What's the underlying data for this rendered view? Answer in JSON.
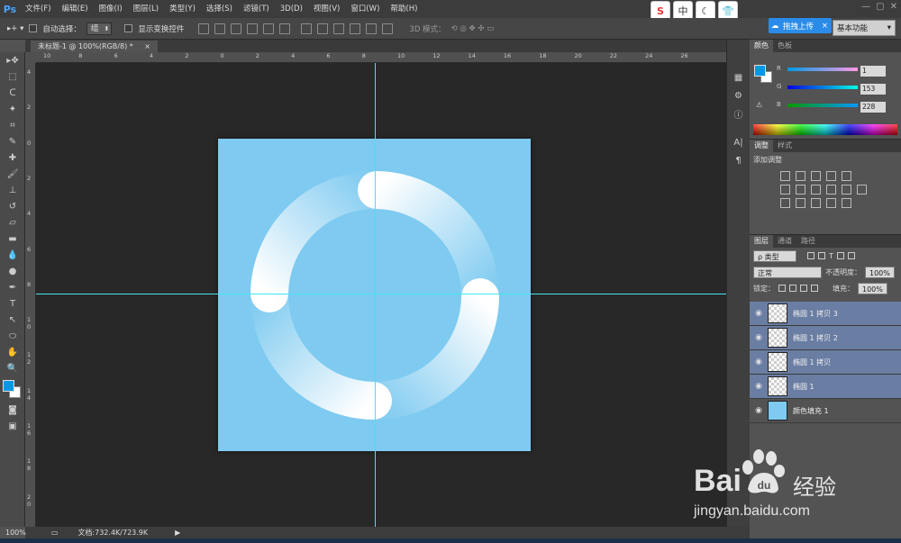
{
  "app": {
    "logo": "Ps"
  },
  "menu": [
    "文件(F)",
    "编辑(E)",
    "图像(I)",
    "图层(L)",
    "类型(Y)",
    "选择(S)",
    "滤镜(T)",
    "3D(D)",
    "视图(V)",
    "窗口(W)",
    "帮助(H)"
  ],
  "ext_icons": [
    "S",
    "中",
    "☾",
    "👕"
  ],
  "options": {
    "auto_select_label": "自动选择：",
    "auto_select_value": "组",
    "show_transform_label": "显示变换控件",
    "mode3d_label": "3D 模式："
  },
  "upload_button": "拖拽上传",
  "workspace": "基本功能",
  "document_tab": "未标题-1 @ 100%(RGB/8) *",
  "ruler_top_labels": [
    "10",
    "8",
    "6",
    "4",
    "2",
    "0",
    "2",
    "4",
    "6",
    "8",
    "10",
    "12",
    "14",
    "16",
    "18",
    "20",
    "22",
    "24",
    "26"
  ],
  "ruler_left_labels": [
    "4",
    "2",
    "0",
    "2",
    "4",
    "6",
    "8",
    "1 0",
    "1 2",
    "1 4",
    "1 6",
    "1 8",
    "2 0",
    "2 2"
  ],
  "color_panel": {
    "tabs": [
      "颜色",
      "色板"
    ],
    "channels": [
      {
        "label": "R",
        "value": "1"
      },
      {
        "label": "G",
        "value": "153"
      },
      {
        "label": "B",
        "value": "228"
      }
    ],
    "fg_color": "#0199e4"
  },
  "adjust_panel": {
    "tabs": [
      "调整",
      "样式"
    ],
    "title": "添加调整"
  },
  "layers_panel": {
    "tabs": [
      "图层",
      "通道",
      "路径"
    ],
    "filter_label": "ρ 类型",
    "blend_mode": "正常",
    "opacity_label": "不透明度：",
    "opacity_value": "100%",
    "lock_label": "锁定：",
    "fill_label": "填充：",
    "fill_value": "100%",
    "layers": [
      {
        "name": "椭圆 1 拷贝 3",
        "selected": true
      },
      {
        "name": "椭圆 1 拷贝 2",
        "selected": true
      },
      {
        "name": "椭圆 1 拷贝",
        "selected": true
      },
      {
        "name": "椭圆 1",
        "selected": true
      },
      {
        "name": "颜色填充 1",
        "selected": false
      }
    ]
  },
  "status": {
    "zoom": "100%",
    "doc_info": "文档:732.4K/723.9K"
  },
  "canvas_color": "#7ecaf0",
  "watermark": {
    "text": "Bai",
    "cn": "经验",
    "url": "jingyan.baidu.com"
  }
}
